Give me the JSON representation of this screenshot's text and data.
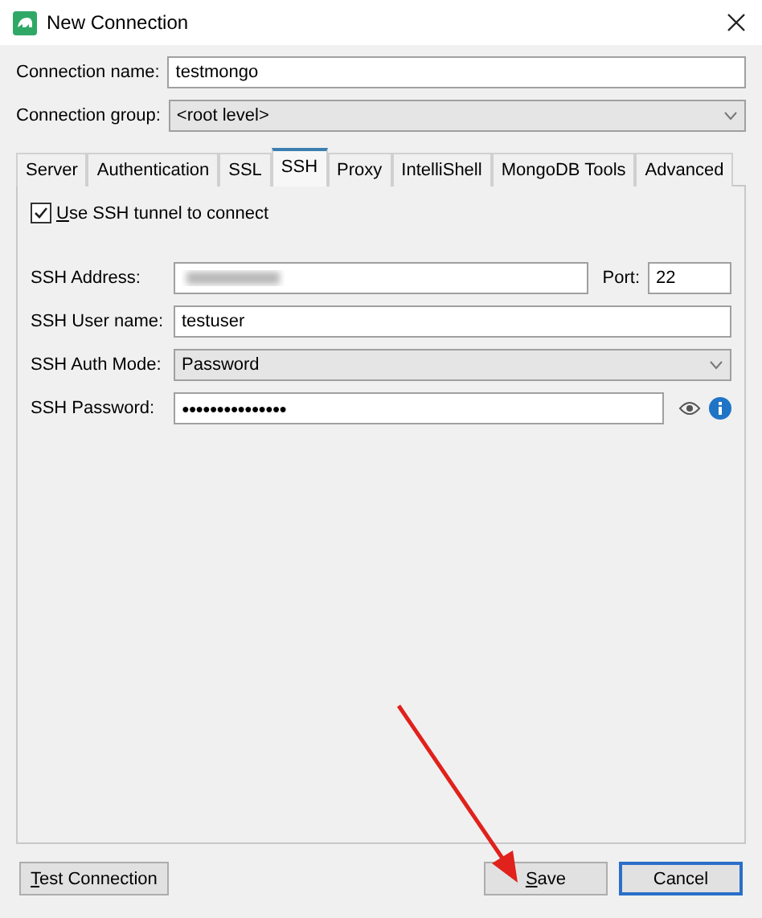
{
  "window": {
    "title": "New Connection"
  },
  "connection_name": {
    "label": "Connection name:",
    "value": "testmongo"
  },
  "connection_group": {
    "label": "Connection group:",
    "value": "<root level>"
  },
  "tabs": [
    {
      "label": "Server",
      "selected": false
    },
    {
      "label": "Authentication",
      "selected": false
    },
    {
      "label": "SSL",
      "selected": false
    },
    {
      "label": "SSH",
      "selected": true
    },
    {
      "label": "Proxy",
      "selected": false
    },
    {
      "label": "IntelliShell",
      "selected": false
    },
    {
      "label": "MongoDB Tools",
      "selected": false
    },
    {
      "label": "Advanced",
      "selected": false
    }
  ],
  "ssh": {
    "tunnel": {
      "label": "Use SSH tunnel to connect",
      "checked": true,
      "first_letter_underlined": true
    },
    "address": {
      "label": "SSH Address:"
    },
    "port": {
      "label": "Port:",
      "value": "22"
    },
    "user": {
      "label": "SSH User name:",
      "value": "testuser"
    },
    "auth_mode": {
      "label": "SSH Auth Mode:",
      "value": "Password"
    },
    "password": {
      "label": "SSH Password:",
      "value": "●●●●●●●●●●●●●●●"
    }
  },
  "buttons": [
    {
      "label": "Test Connection",
      "first_letter_underlined": true,
      "default": false
    },
    {
      "label": "Save",
      "first_letter_underlined": true,
      "default": false
    },
    {
      "label": "Cancel",
      "first_letter_underlined": false,
      "default": true
    }
  ]
}
